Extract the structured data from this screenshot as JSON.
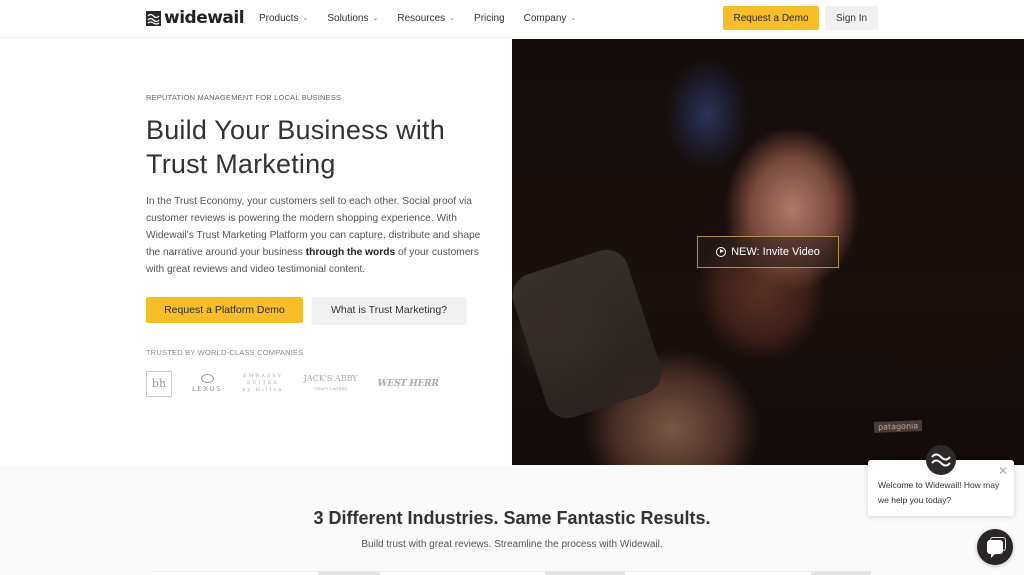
{
  "header": {
    "logo_text": "widewail",
    "nav": [
      {
        "label": "Products",
        "has_dropdown": true
      },
      {
        "label": "Solutions",
        "has_dropdown": true
      },
      {
        "label": "Resources",
        "has_dropdown": true
      },
      {
        "label": "Pricing",
        "has_dropdown": false
      },
      {
        "label": "Company",
        "has_dropdown": true
      }
    ],
    "caret": "⌄",
    "request_demo_label": "Request a Demo",
    "sign_in_label": "Sign In"
  },
  "hero": {
    "eyebrow": "REPUTATION MANAGEMENT FOR LOCAL BUSINESS",
    "title_line1": "Build Your Business with",
    "title_line2": "Trust Marketing",
    "body_before_bold": "In the Trust Economy, your customers sell to each other. Social proof via customer reviews is powering the modern shopping experience. With Widewail's Trust Marketing Platform you can capture, distribute and shape the narrative around your business ",
    "body_bold": "through the words",
    "body_after_bold": " of your customers with great reviews and video testimonial content.",
    "primary_cta": "Request a Platform Demo",
    "secondary_cta": "What is Trust Marketing?",
    "trusted_label": "TRUSTED BY WORLD-CLASS COMPANIES",
    "client_logos": {
      "bh": "bh",
      "lexus": "LEXUS",
      "embassy_line1": "EMBASSY",
      "embassy_line2": "SUITES",
      "embassy_line3": "by Hilton",
      "jacks_abby": "JACK'S ABBY",
      "jacks_abby_sub": "CRAFT LAGERS",
      "west_herr": "WEST HERR"
    },
    "video_badge": "NEW: Invite Video",
    "jacket_brand": "patagonia"
  },
  "industries": {
    "title": "3 Different Industries. Same Fantastic Results.",
    "subtitle": "Build trust with great reviews. Streamline the process with Widewail."
  },
  "chat": {
    "message": "Welcome to Widewail! How may we help you today?",
    "close": "✕"
  },
  "colors": {
    "accent": "#f7be2a",
    "secondary_button": "#f1f1f1",
    "video_border": "#b08d4c",
    "chat_dark": "#2a2626"
  }
}
